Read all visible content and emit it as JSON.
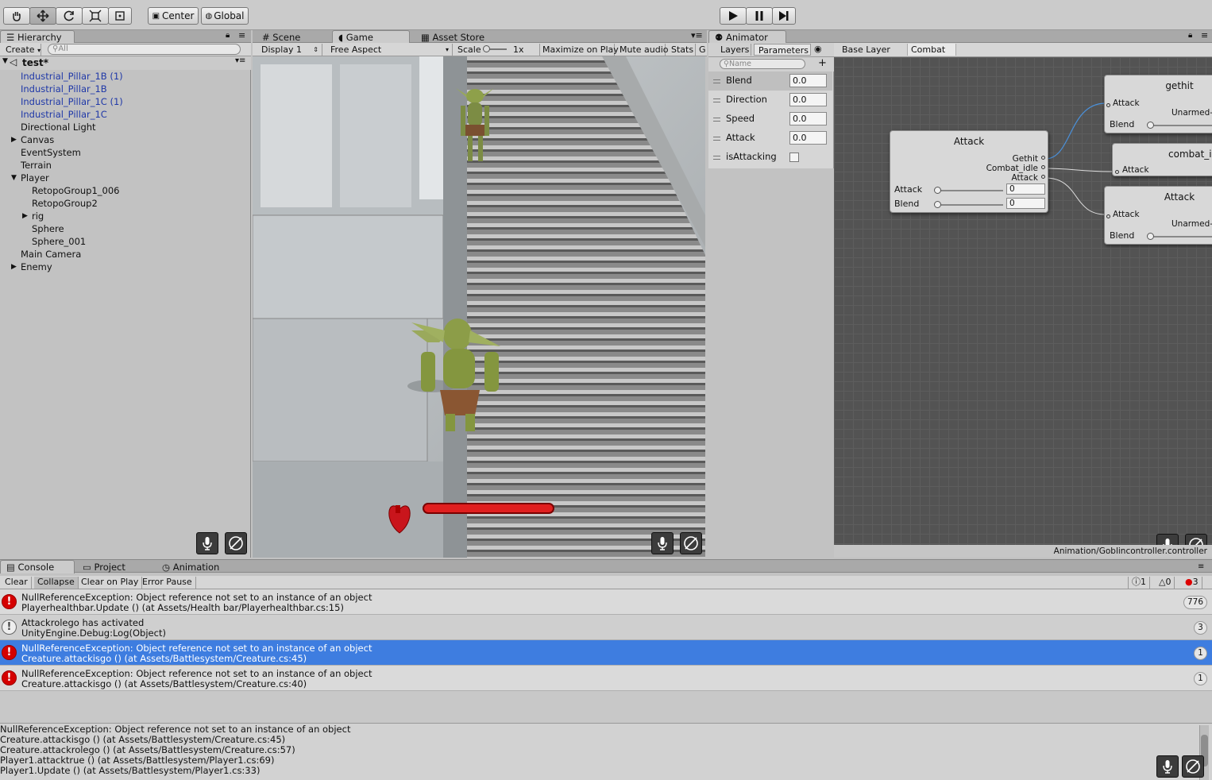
{
  "toolbar": {
    "tools": [
      "hand-icon",
      "move-icon",
      "rotate-icon",
      "scale-icon",
      "rect-icon"
    ],
    "pivot_label": "Center",
    "space_label": "Global"
  },
  "hierarchy": {
    "tab_label": "Hierarchy",
    "create_label": "Create",
    "search_placeholder": "All",
    "scene_name": "test*",
    "items": [
      {
        "label": "Industrial_Pillar_1B (1)",
        "prefab": true
      },
      {
        "label": "Industrial_Pillar_1B",
        "prefab": true
      },
      {
        "label": "Industrial_Pillar_1C (1)",
        "prefab": true
      },
      {
        "label": "Industrial_Pillar_1C",
        "prefab": true
      },
      {
        "label": "Directional Light"
      },
      {
        "label": "Canvas"
      },
      {
        "label": "EventSystem"
      },
      {
        "label": "Terrain"
      },
      {
        "label": "Player"
      },
      {
        "label": "RetopoGroup1_006"
      },
      {
        "label": "RetopoGroup2"
      },
      {
        "label": "rig"
      },
      {
        "label": "Sphere"
      },
      {
        "label": "Sphere_001"
      },
      {
        "label": "Main Camera"
      },
      {
        "label": "Enemy"
      }
    ]
  },
  "game": {
    "tabs": [
      "Scene",
      "Game",
      "Asset Store"
    ],
    "display": "Display 1",
    "aspect": "Free Aspect",
    "scale_label": "Scale",
    "scale_value": "1x",
    "maximize": "Maximize on Play",
    "mute": "Mute audio",
    "stats": "Stats",
    "gizmos": "G",
    "health_fraction": 1.0
  },
  "animator": {
    "tab_label": "Animator",
    "subtabs": [
      "Layers",
      "Parameters"
    ],
    "search_placeholder": "Name",
    "breadcrumbs": [
      "Base Layer",
      "Combat"
    ],
    "parameters": [
      {
        "name": "Blend",
        "value": "0.0"
      },
      {
        "name": "Direction",
        "value": "0.0"
      },
      {
        "name": "Speed",
        "value": "0.0"
      },
      {
        "name": "Attack",
        "value": "0.0"
      },
      {
        "name": "isAttacking",
        "value": ""
      }
    ],
    "path": "Animation/Goblincontroller.controller",
    "nodes": {
      "attack_main": {
        "title": "Attack",
        "outputs": [
          "Gethit",
          "Combat_idle",
          "Attack"
        ],
        "inputs": [
          {
            "label": "Attack",
            "value": "0"
          },
          {
            "label": "Blend",
            "value": "0"
          }
        ]
      },
      "gethit": {
        "title": "gethit",
        "input": "Attack",
        "output": "Unarmed-",
        "blend": "Blend"
      },
      "combat_idle": {
        "title": "combat_id",
        "input": "Attack"
      },
      "attack_right": {
        "title": "Attack",
        "input": "Attack",
        "output": "Unarmed-",
        "blend": "Blend"
      }
    }
  },
  "console": {
    "tabs": [
      "Console",
      "Project",
      "Animation"
    ],
    "buttons": [
      "Clear",
      "Collapse",
      "Clear on Play",
      "Error Pause"
    ],
    "counts": {
      "info": "1",
      "warn": "0",
      "error": "3"
    },
    "entries": [
      {
        "type": "error",
        "line1": "NullReferenceException: Object reference not set to an instance of an object",
        "line2": "Playerhealthbar.Update () (at Assets/Health bar/Playerhealthbar.cs:15)",
        "count": "776"
      },
      {
        "type": "info",
        "line1": "Attackrolego has activated",
        "line2": "UnityEngine.Debug:Log(Object)",
        "count": "3"
      },
      {
        "type": "error",
        "line1": "NullReferenceException: Object reference not set to an instance of an object",
        "line2": "Creature.attackisgo () (at Assets/Battlesystem/Creature.cs:45)",
        "count": "1",
        "selected": true
      },
      {
        "type": "error",
        "line1": "NullReferenceException: Object reference not set to an instance of an object",
        "line2": "Creature.attackisgo () (at Assets/Battlesystem/Creature.cs:40)",
        "count": "1"
      }
    ],
    "details": [
      "NullReferenceException: Object reference not set to an instance of an object",
      "Creature.attackisgo () (at Assets/Battlesystem/Creature.cs:45)",
      "Creature.attackrolego () (at Assets/Battlesystem/Creature.cs:57)",
      "Player1.attacktrue () (at Assets/Battlesystem/Player1.cs:69)",
      "Player1.Update () (at Assets/Battlesystem/Player1.cs:33)"
    ]
  },
  "colors": {
    "selection": "#3e7de0",
    "error": "#d50000",
    "prefab_text": "#1f38a8",
    "graph_bg": "#535353"
  }
}
